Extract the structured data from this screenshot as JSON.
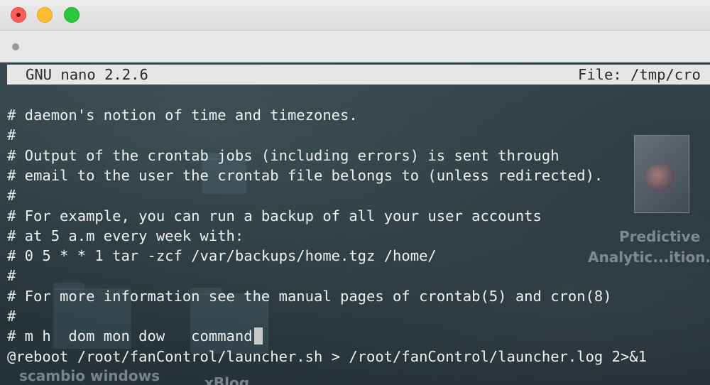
{
  "window": {
    "traffic_lights": [
      "close",
      "minimize",
      "zoom"
    ],
    "colors": {
      "close": "#fd5f57",
      "minimize": "#febc2e",
      "zoom": "#28c840"
    }
  },
  "nano": {
    "version": "GNU nano 2.2.6",
    "file": "File: /tmp/cro"
  },
  "lines": [
    "# daemon's notion of time and timezones.",
    "#",
    "# Output of the crontab jobs (including errors) is sent through",
    "# email to the user the crontab file belongs to (unless redirected).",
    "#",
    "# For example, you can run a backup of all your user accounts",
    "# at 5 a.m every week with:",
    "# 0 5 * * 1 tar -zcf /var/backups/home.tgz /home/",
    "#",
    "# For more information see the manual pages of crontab(5) and cron(8)",
    "#",
    "# m h  dom mon dow   command",
    "@reboot /root/fanControl/launcher.sh > /root/fanControl/launcher.log 2>&1"
  ],
  "desktop": {
    "labels": [
      "Predictive",
      "Analytic...ition.",
      "scambio windows",
      "xBlog"
    ]
  }
}
